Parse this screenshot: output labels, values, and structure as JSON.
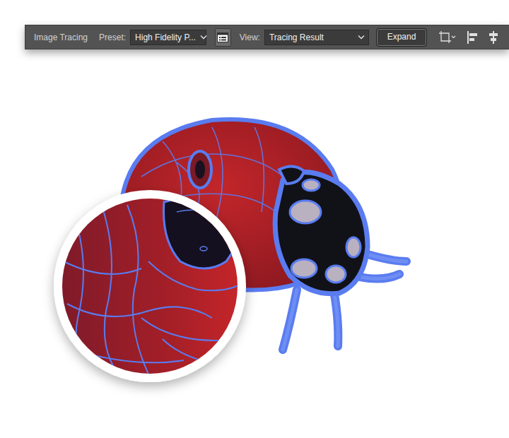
{
  "toolbar": {
    "title": "Image Tracing",
    "preset": {
      "label": "Preset:",
      "value": "High Fidelity P..."
    },
    "view": {
      "label": "View:",
      "value": "Tracing Result"
    },
    "expand_button": "Expand"
  }
}
